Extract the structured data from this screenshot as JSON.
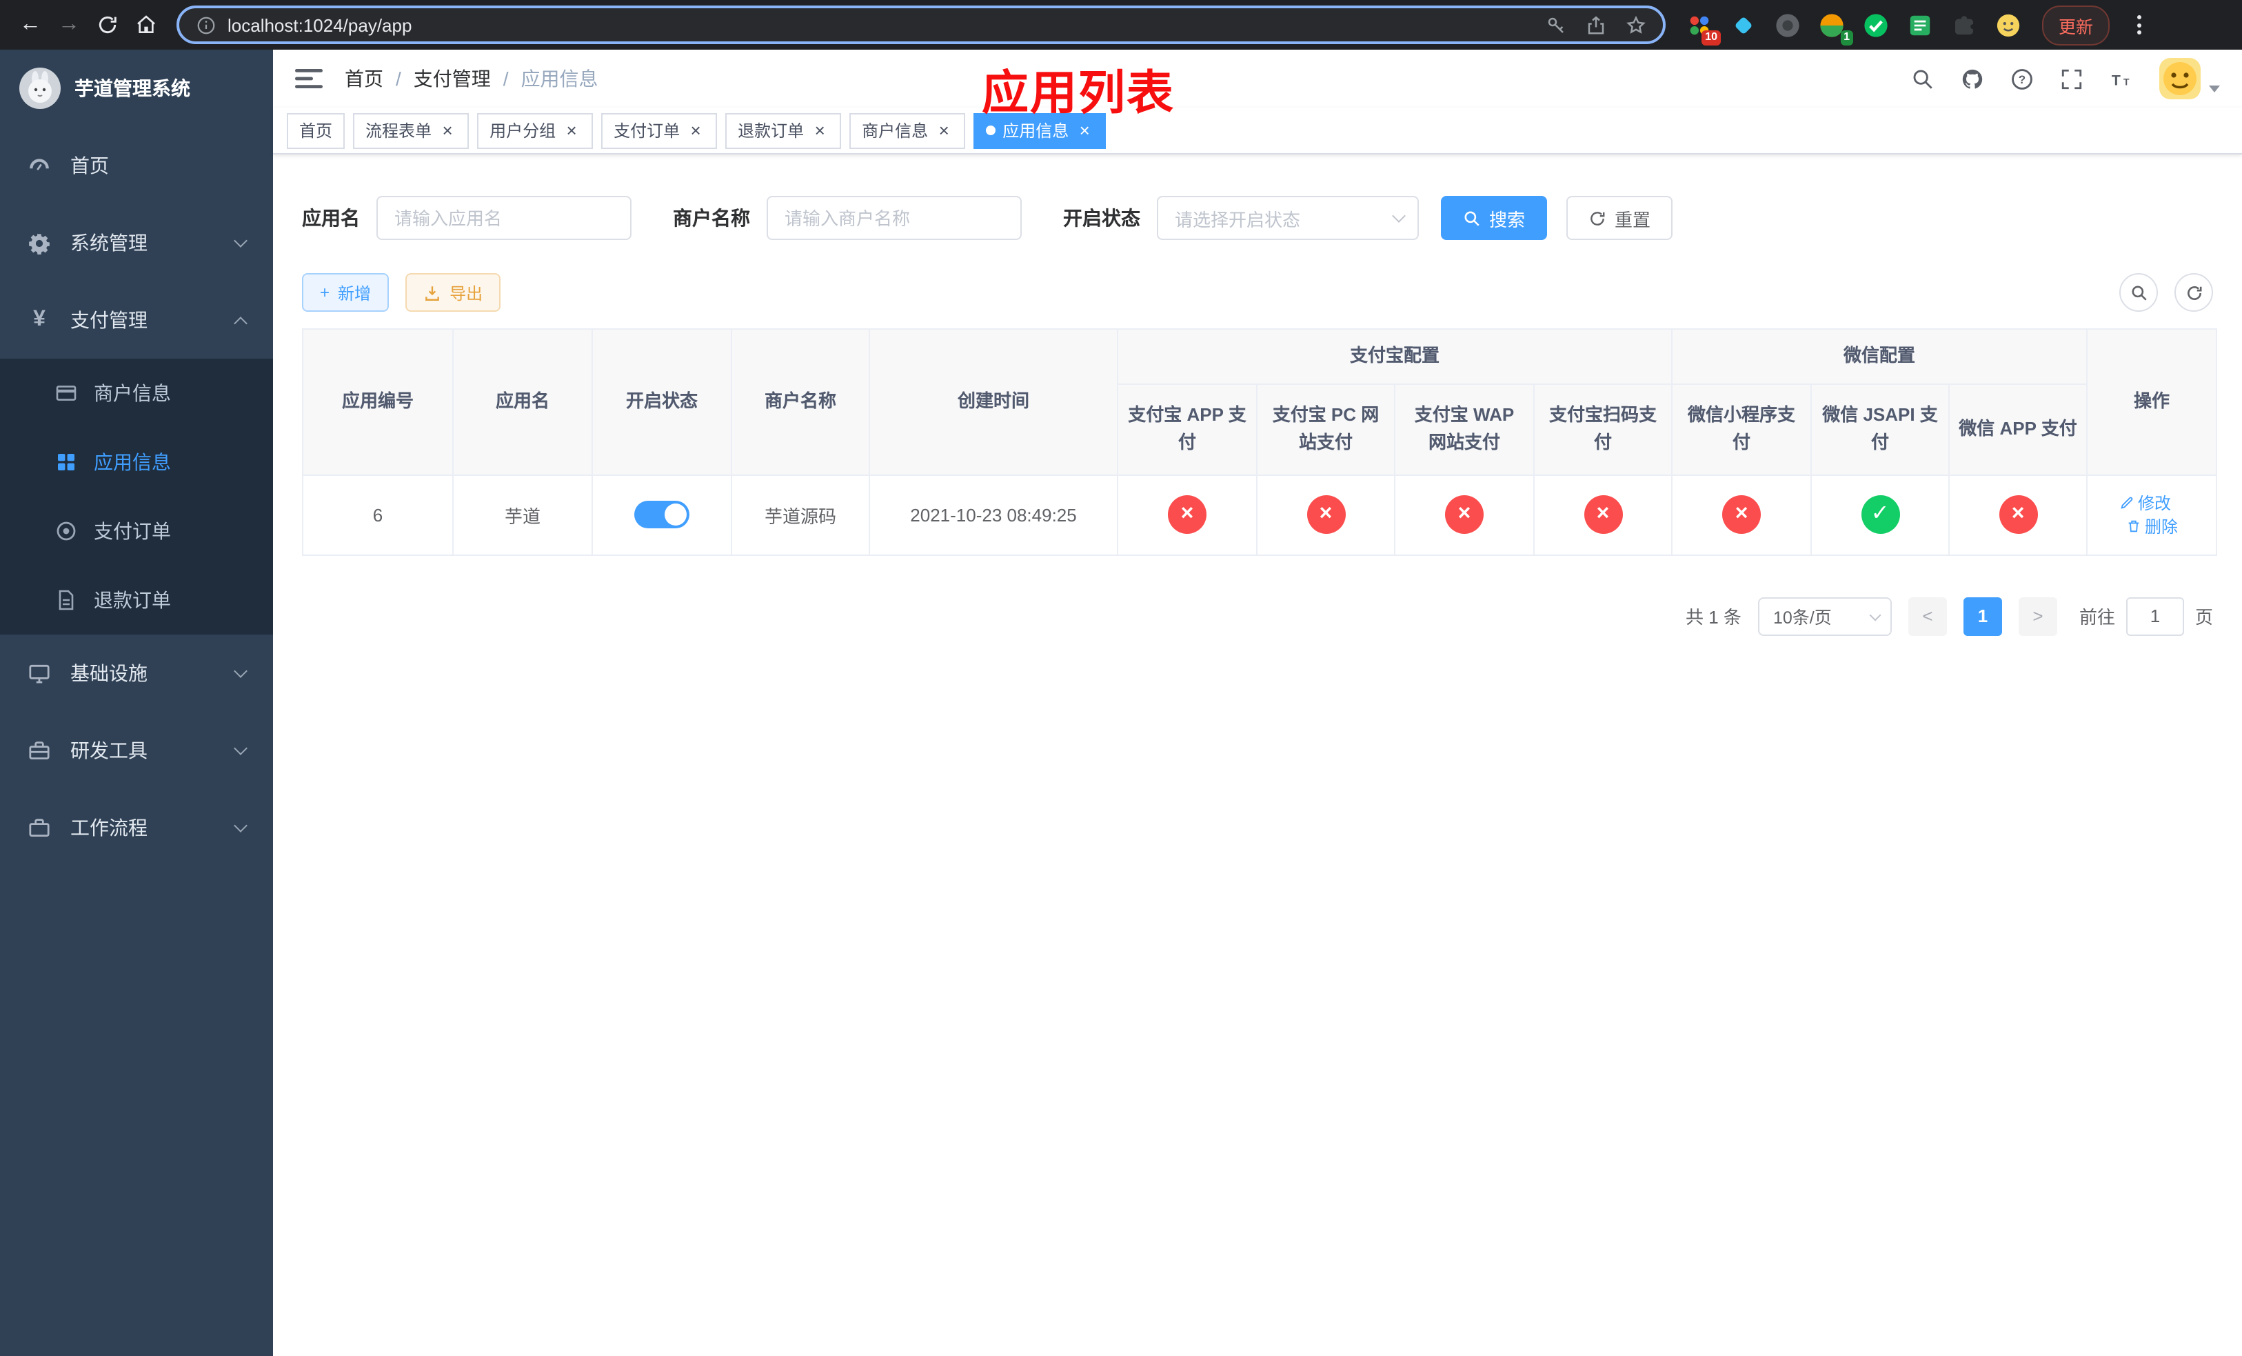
{
  "browser": {
    "url": "localhost:1024/pay/app",
    "update_label": "更新",
    "ext_badge_count": "10",
    "avatar_badge_count": "1"
  },
  "sidebar": {
    "title": "芋道管理系统",
    "menu": [
      {
        "label": "首页"
      },
      {
        "label": "系统管理"
      },
      {
        "label": "支付管理"
      },
      {
        "label": "基础设施"
      },
      {
        "label": "研发工具"
      },
      {
        "label": "工作流程"
      }
    ],
    "submenu": [
      {
        "label": "商户信息"
      },
      {
        "label": "应用信息"
      },
      {
        "label": "支付订单"
      },
      {
        "label": "退款订单"
      }
    ]
  },
  "header": {
    "breadcrumb": [
      "首页",
      "支付管理",
      "应用信息"
    ],
    "annotation": "应用列表"
  },
  "tabs": [
    {
      "label": "首页"
    },
    {
      "label": "流程表单"
    },
    {
      "label": "用户分组"
    },
    {
      "label": "支付订单"
    },
    {
      "label": "退款订单"
    },
    {
      "label": "商户信息"
    },
    {
      "label": "应用信息"
    }
  ],
  "filters": {
    "app_name_label": "应用名",
    "app_name_placeholder": "请输入应用名",
    "merchant_label": "商户名称",
    "merchant_placeholder": "请输入商户名称",
    "status_label": "开启状态",
    "status_placeholder": "请选择开启状态",
    "search_label": "搜索",
    "reset_label": "重置"
  },
  "toolbar": {
    "add_label": "新增",
    "export_label": "导出"
  },
  "table": {
    "static_headers": [
      "应用编号",
      "应用名",
      "开启状态",
      "商户名称",
      "创建时间"
    ],
    "group_alipay": "支付宝配置",
    "group_wechat": "微信配置",
    "sub_headers": [
      "支付宝 APP 支付",
      "支付宝 PC 网站支付",
      "支付宝 WAP 网站支付",
      "支付宝扫码支付",
      "微信小程序支付",
      "微信 JSAPI 支付",
      "微信 APP 支付"
    ],
    "op_header": "操作",
    "rows": [
      {
        "id": "6",
        "name": "芋道",
        "enabled": true,
        "merchant": "芋道源码",
        "created": "2021-10-23 08:49:25",
        "configs": [
          false,
          false,
          false,
          false,
          false,
          true,
          false
        ]
      }
    ],
    "actions": {
      "edit_label": "修改",
      "delete_label": "删除"
    }
  },
  "pagination": {
    "total_label": "共 1 条",
    "page_size_label": "10条/页",
    "current_page": "1",
    "goto_label": "前往",
    "goto_value": "1",
    "page_unit_label": "页"
  },
  "colors": {
    "accent": "#409eff",
    "success": "#13ce66",
    "danger": "#fb4d4d",
    "sidebar_bg": "#304156",
    "annotation": "#f70f0f"
  }
}
